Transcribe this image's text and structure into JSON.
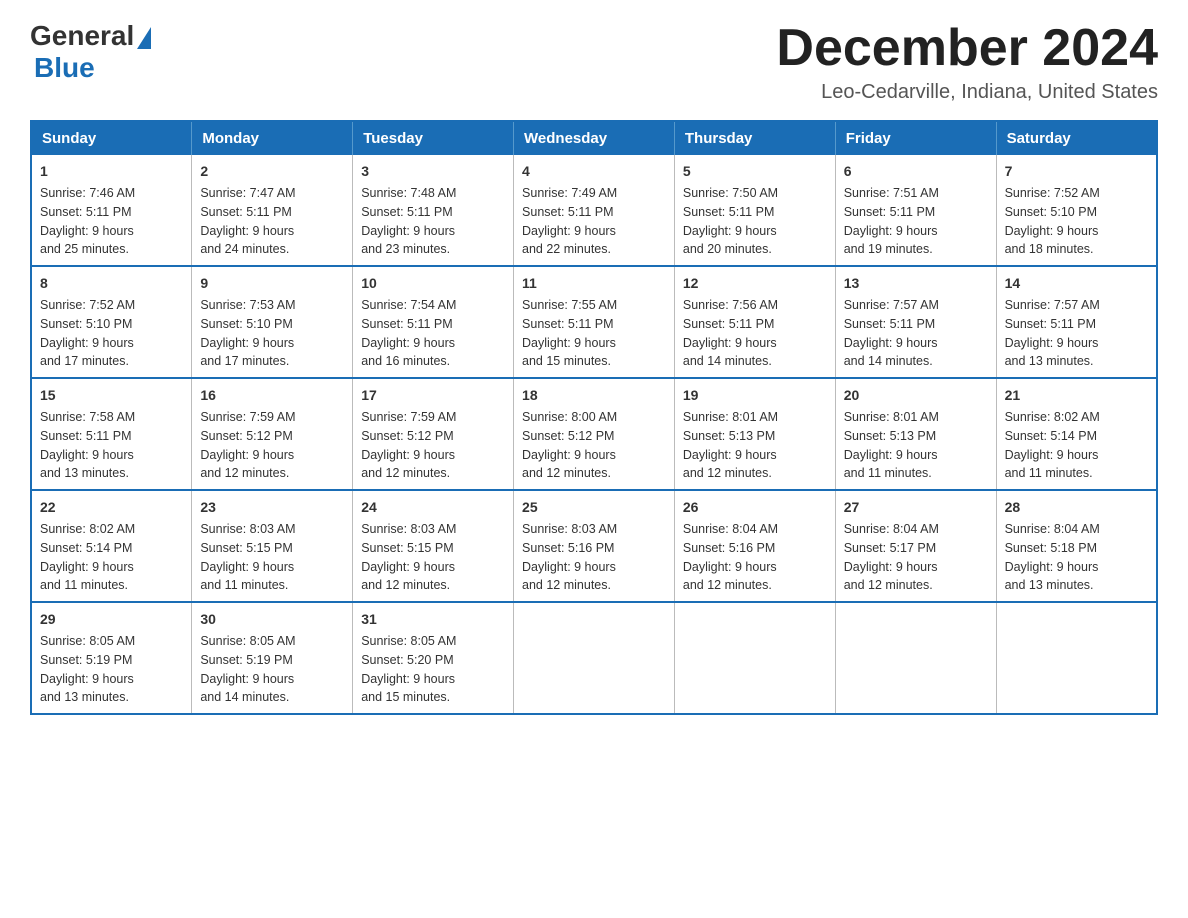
{
  "logo": {
    "general": "General",
    "blue": "Blue"
  },
  "title": "December 2024",
  "location": "Leo-Cedarville, Indiana, United States",
  "weekdays": [
    "Sunday",
    "Monday",
    "Tuesday",
    "Wednesday",
    "Thursday",
    "Friday",
    "Saturday"
  ],
  "weeks": [
    [
      {
        "day": "1",
        "sunrise": "7:46 AM",
        "sunset": "5:11 PM",
        "daylight": "9 hours and 25 minutes."
      },
      {
        "day": "2",
        "sunrise": "7:47 AM",
        "sunset": "5:11 PM",
        "daylight": "9 hours and 24 minutes."
      },
      {
        "day": "3",
        "sunrise": "7:48 AM",
        "sunset": "5:11 PM",
        "daylight": "9 hours and 23 minutes."
      },
      {
        "day": "4",
        "sunrise": "7:49 AM",
        "sunset": "5:11 PM",
        "daylight": "9 hours and 22 minutes."
      },
      {
        "day": "5",
        "sunrise": "7:50 AM",
        "sunset": "5:11 PM",
        "daylight": "9 hours and 20 minutes."
      },
      {
        "day": "6",
        "sunrise": "7:51 AM",
        "sunset": "5:11 PM",
        "daylight": "9 hours and 19 minutes."
      },
      {
        "day": "7",
        "sunrise": "7:52 AM",
        "sunset": "5:10 PM",
        "daylight": "9 hours and 18 minutes."
      }
    ],
    [
      {
        "day": "8",
        "sunrise": "7:52 AM",
        "sunset": "5:10 PM",
        "daylight": "9 hours and 17 minutes."
      },
      {
        "day": "9",
        "sunrise": "7:53 AM",
        "sunset": "5:10 PM",
        "daylight": "9 hours and 17 minutes."
      },
      {
        "day": "10",
        "sunrise": "7:54 AM",
        "sunset": "5:11 PM",
        "daylight": "9 hours and 16 minutes."
      },
      {
        "day": "11",
        "sunrise": "7:55 AM",
        "sunset": "5:11 PM",
        "daylight": "9 hours and 15 minutes."
      },
      {
        "day": "12",
        "sunrise": "7:56 AM",
        "sunset": "5:11 PM",
        "daylight": "9 hours and 14 minutes."
      },
      {
        "day": "13",
        "sunrise": "7:57 AM",
        "sunset": "5:11 PM",
        "daylight": "9 hours and 14 minutes."
      },
      {
        "day": "14",
        "sunrise": "7:57 AM",
        "sunset": "5:11 PM",
        "daylight": "9 hours and 13 minutes."
      }
    ],
    [
      {
        "day": "15",
        "sunrise": "7:58 AM",
        "sunset": "5:11 PM",
        "daylight": "9 hours and 13 minutes."
      },
      {
        "day": "16",
        "sunrise": "7:59 AM",
        "sunset": "5:12 PM",
        "daylight": "9 hours and 12 minutes."
      },
      {
        "day": "17",
        "sunrise": "7:59 AM",
        "sunset": "5:12 PM",
        "daylight": "9 hours and 12 minutes."
      },
      {
        "day": "18",
        "sunrise": "8:00 AM",
        "sunset": "5:12 PM",
        "daylight": "9 hours and 12 minutes."
      },
      {
        "day": "19",
        "sunrise": "8:01 AM",
        "sunset": "5:13 PM",
        "daylight": "9 hours and 12 minutes."
      },
      {
        "day": "20",
        "sunrise": "8:01 AM",
        "sunset": "5:13 PM",
        "daylight": "9 hours and 11 minutes."
      },
      {
        "day": "21",
        "sunrise": "8:02 AM",
        "sunset": "5:14 PM",
        "daylight": "9 hours and 11 minutes."
      }
    ],
    [
      {
        "day": "22",
        "sunrise": "8:02 AM",
        "sunset": "5:14 PM",
        "daylight": "9 hours and 11 minutes."
      },
      {
        "day": "23",
        "sunrise": "8:03 AM",
        "sunset": "5:15 PM",
        "daylight": "9 hours and 11 minutes."
      },
      {
        "day": "24",
        "sunrise": "8:03 AM",
        "sunset": "5:15 PM",
        "daylight": "9 hours and 12 minutes."
      },
      {
        "day": "25",
        "sunrise": "8:03 AM",
        "sunset": "5:16 PM",
        "daylight": "9 hours and 12 minutes."
      },
      {
        "day": "26",
        "sunrise": "8:04 AM",
        "sunset": "5:16 PM",
        "daylight": "9 hours and 12 minutes."
      },
      {
        "day": "27",
        "sunrise": "8:04 AM",
        "sunset": "5:17 PM",
        "daylight": "9 hours and 12 minutes."
      },
      {
        "day": "28",
        "sunrise": "8:04 AM",
        "sunset": "5:18 PM",
        "daylight": "9 hours and 13 minutes."
      }
    ],
    [
      {
        "day": "29",
        "sunrise": "8:05 AM",
        "sunset": "5:19 PM",
        "daylight": "9 hours and 13 minutes."
      },
      {
        "day": "30",
        "sunrise": "8:05 AM",
        "sunset": "5:19 PM",
        "daylight": "9 hours and 14 minutes."
      },
      {
        "day": "31",
        "sunrise": "8:05 AM",
        "sunset": "5:20 PM",
        "daylight": "9 hours and 15 minutes."
      },
      null,
      null,
      null,
      null
    ]
  ],
  "labels": {
    "sunrise": "Sunrise:",
    "sunset": "Sunset:",
    "daylight": "Daylight:"
  }
}
